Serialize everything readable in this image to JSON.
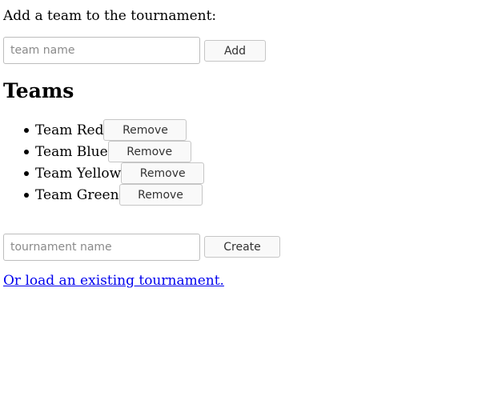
{
  "add_team": {
    "intro_text": "Add a team to the tournament:",
    "input_placeholder": "team name",
    "input_value": "",
    "add_label": "Add"
  },
  "teams": {
    "heading": "Teams",
    "remove_label": "Remove",
    "items": [
      {
        "name": "Team Red"
      },
      {
        "name": "Team Blue"
      },
      {
        "name": "Team Yellow"
      },
      {
        "name": "Team Green"
      }
    ]
  },
  "create_tournament": {
    "input_placeholder": "tournament name",
    "input_value": "",
    "create_label": "Create"
  },
  "load_link": {
    "text": "Or load an existing tournament."
  }
}
